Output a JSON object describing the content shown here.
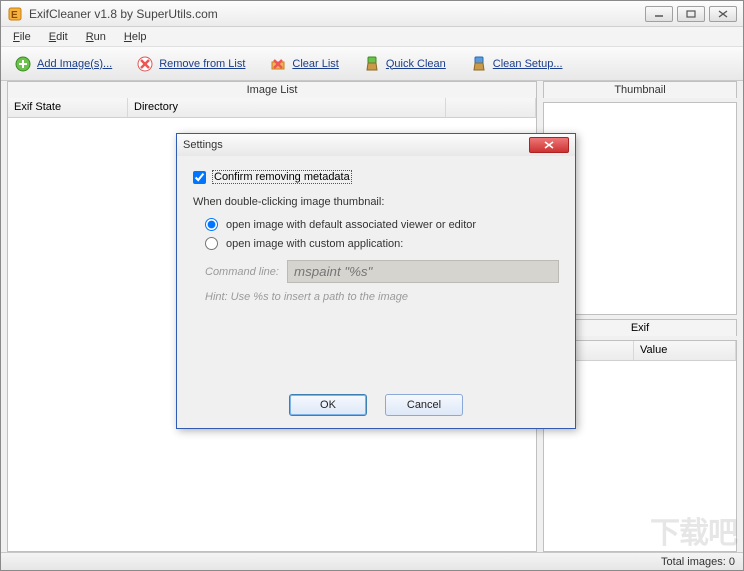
{
  "window": {
    "title": "ExifCleaner v1.8 by SuperUtils.com"
  },
  "menu": {
    "items": [
      "File",
      "Edit",
      "Run",
      "Help"
    ]
  },
  "toolbar": {
    "add_images": "Add Image(s)...",
    "remove": "Remove from List",
    "clear": "Clear List",
    "quick_clean": "Quick Clean",
    "clean_setup": "Clean Setup..."
  },
  "panels": {
    "image_list": "Image List",
    "thumbnail": "Thumbnail",
    "exif": "Exif"
  },
  "columns": {
    "exif_state": "Exif State",
    "directory": "Directory",
    "property": "",
    "value": "Value"
  },
  "status": {
    "text": "Total images: 0"
  },
  "dialog": {
    "title": "Settings",
    "confirm_removing": "Confirm removing metadata",
    "confirm_removing_checked": true,
    "group_title": "When double-clicking image thumbnail:",
    "radio1": "open image with default associated viewer or editor",
    "radio2": "open image with custom application:",
    "radio_selected": 1,
    "cmd_label": "Command line:",
    "cmd_placeholder": "mspaint \"%s\"",
    "hint": "Hint: Use %s to insert a path to the image",
    "ok": "OK",
    "cancel": "Cancel"
  },
  "watermark": "下载吧"
}
